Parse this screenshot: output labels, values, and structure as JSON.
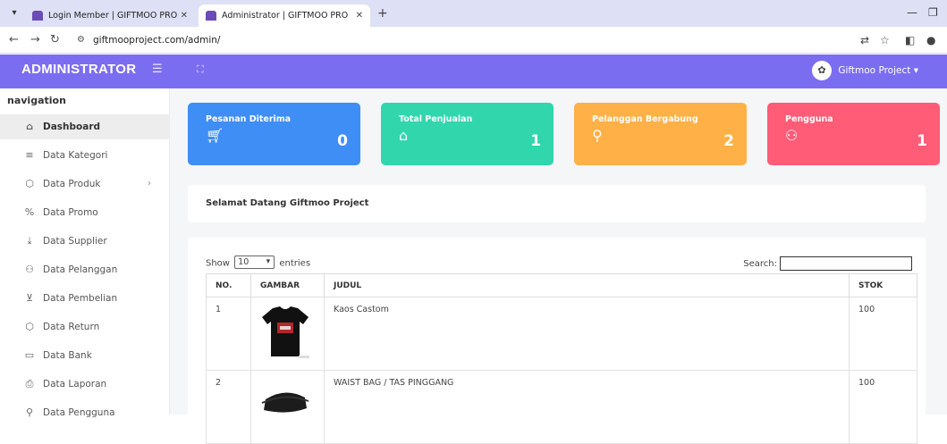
{
  "browser": {
    "tabs": [
      {
        "title": "Login Member | GIFTMOO PRO",
        "close": "✕"
      },
      {
        "title": "Administrator | GIFTMOO PRO",
        "close": "✕"
      }
    ],
    "new_tab": "+",
    "url": "giftmooproject.com/admin/"
  },
  "topbar": {
    "brand": "ADMINISTRATOR",
    "user_name": "Giftmoo Project"
  },
  "sidebar": {
    "title": "navigation",
    "items": [
      {
        "label": "Dashboard",
        "icon": "home-icon"
      },
      {
        "label": "Data Kategori",
        "icon": "list-icon"
      },
      {
        "label": "Data Produk",
        "icon": "box-icon"
      },
      {
        "label": "Data Promo",
        "icon": "percent-icon"
      },
      {
        "label": "Data Supplier",
        "icon": "download-icon"
      },
      {
        "label": "Data Pelanggan",
        "icon": "users-icon"
      },
      {
        "label": "Data Pembelian",
        "icon": "cart-icon"
      },
      {
        "label": "Data Return",
        "icon": "box-icon"
      },
      {
        "label": "Data Bank",
        "icon": "card-icon"
      },
      {
        "label": "Data Laporan",
        "icon": "printer-icon"
      },
      {
        "label": "Data Pengguna",
        "icon": "user-icon"
      }
    ]
  },
  "cards": [
    {
      "label": "Pesanan Diterima",
      "value": "0",
      "icon": "cart-icon",
      "color": "#3f8ef5"
    },
    {
      "label": "Total Penjualan",
      "value": "1",
      "icon": "tag-icon",
      "color": "#31d6ad"
    },
    {
      "label": "Pelanggan Bergabung",
      "value": "2",
      "icon": "user-icon",
      "color": "#ffb046"
    },
    {
      "label": "Pengguna",
      "value": "1",
      "icon": "users-icon",
      "color": "#ff5c77"
    }
  ],
  "welcome": "Selamat Datang Giftmoo Project",
  "table": {
    "show_label": "Show",
    "entries_value": "10",
    "entries_label": "entries",
    "search_label": "Search:",
    "headers": [
      "NO.",
      "GAMBAR",
      "JUDUL",
      "STOK"
    ],
    "rows": [
      {
        "no": "1",
        "judul": "Kaos Castom",
        "stok": "100",
        "image": "tshirt-image"
      },
      {
        "no": "2",
        "judul": "WAIST BAG / TAS PINGGANG",
        "stok": "100",
        "image": "waist-bag-image"
      }
    ]
  },
  "colors": {
    "accent": "#7b6df0",
    "tabstrip": "#dee1f5"
  }
}
